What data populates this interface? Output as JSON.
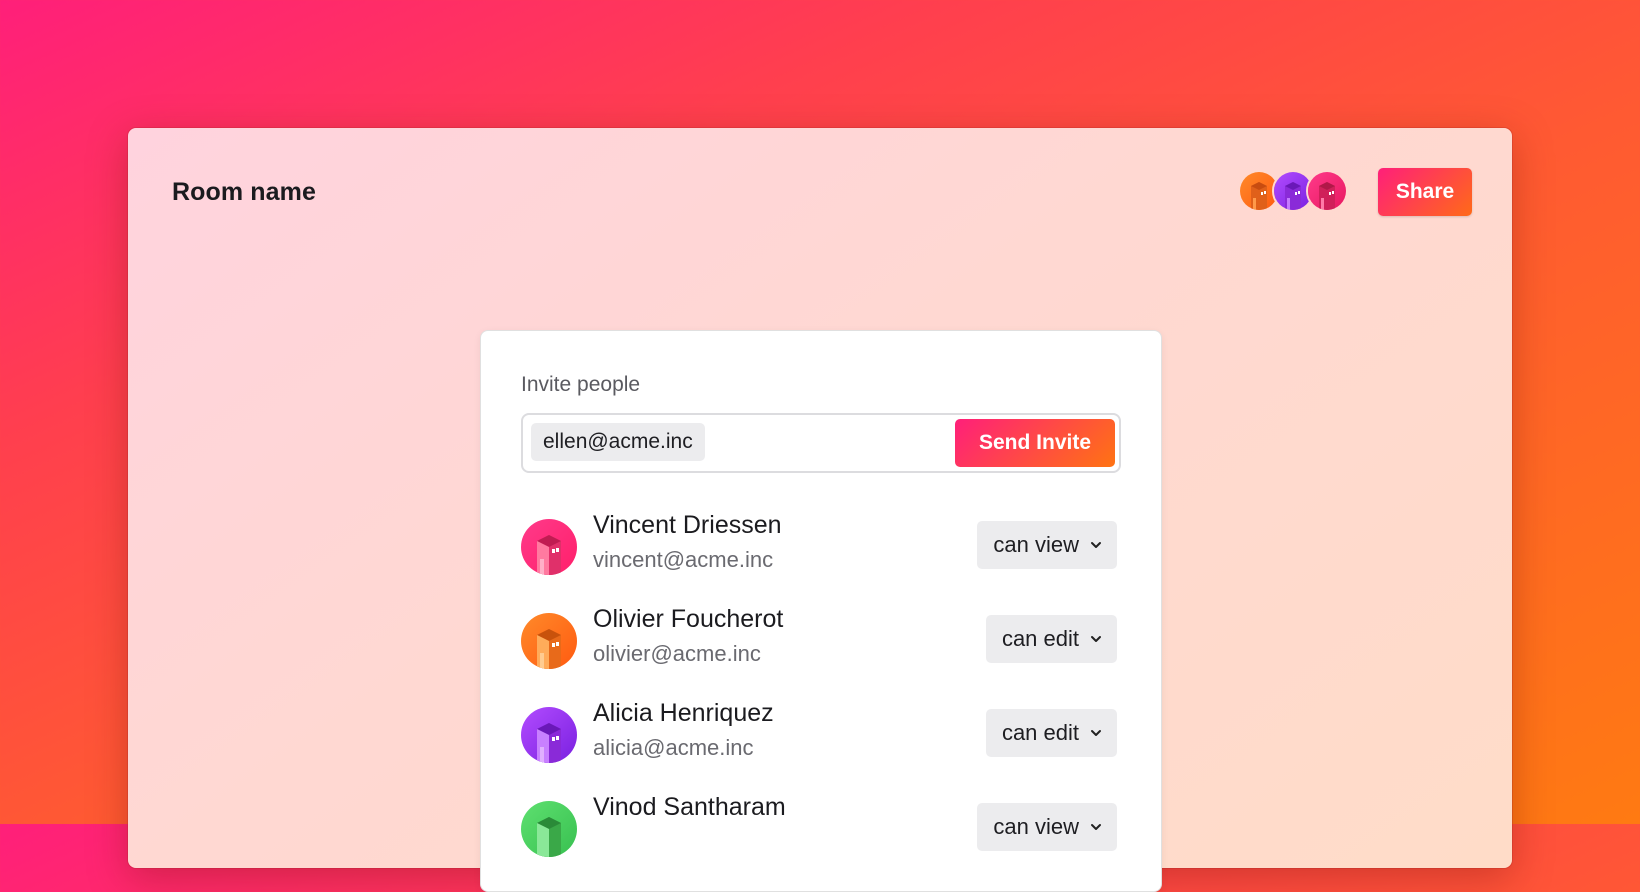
{
  "room": {
    "title": "Room name"
  },
  "header": {
    "share_label": "Share"
  },
  "colors": {
    "pink": "#ff1f7a",
    "orange": "#ff7312",
    "purple": "#a23cf0",
    "green": "#4fd060"
  },
  "presence": [
    {
      "name": "orange-avatar",
      "color": "#ff7312"
    },
    {
      "name": "purple-avatar",
      "color": "#a23cf0"
    },
    {
      "name": "pink-avatar",
      "color": "#ff1f7a"
    }
  ],
  "invite": {
    "label": "Invite people",
    "chip_email": "ellen@acme.inc",
    "send_label": "Send Invite"
  },
  "people": [
    {
      "name": "Vincent Driessen",
      "email": "vincent@acme.inc",
      "permission": "can view",
      "avatar_icon": "building-avatar-pink"
    },
    {
      "name": "Olivier Foucherot",
      "email": "olivier@acme.inc",
      "permission": "can edit",
      "avatar_icon": "building-avatar-orange"
    },
    {
      "name": "Alicia Henriquez",
      "email": "alicia@acme.inc",
      "permission": "can edit",
      "avatar_icon": "building-avatar-purple"
    },
    {
      "name": "Vinod Santharam",
      "email": "",
      "permission": "can view",
      "avatar_icon": "building-avatar-green"
    }
  ]
}
